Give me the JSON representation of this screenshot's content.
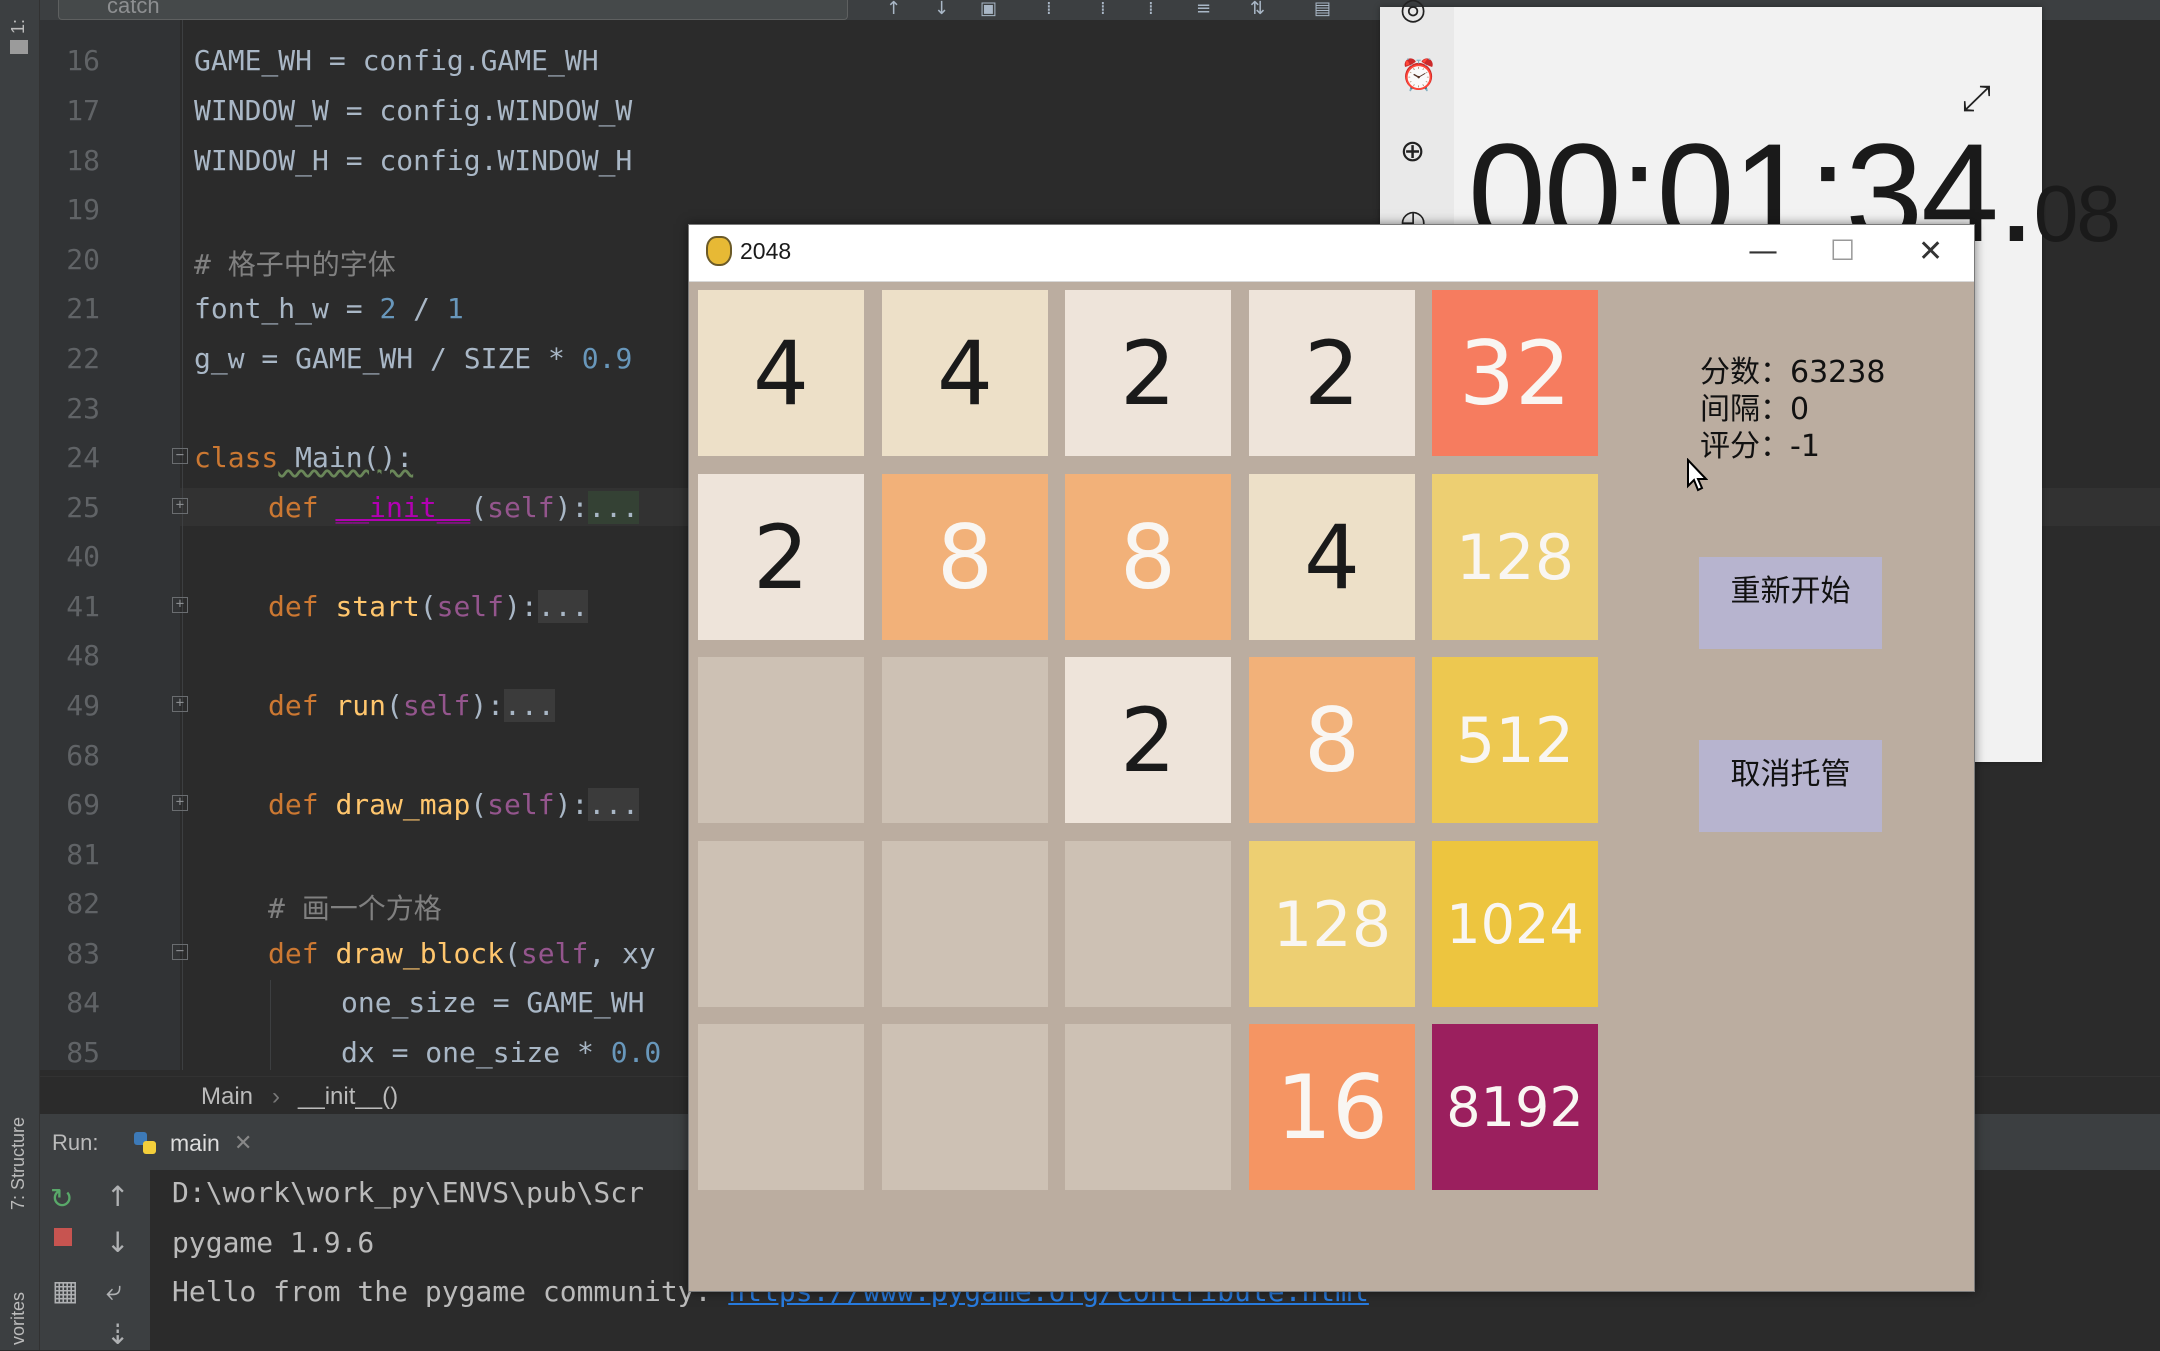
{
  "ide": {
    "search_text": "catch",
    "side_project_label": "1:",
    "side_structure_label": "7: Structure",
    "side_favorites_label": "vorites",
    "line_numbers": [
      "16",
      "17",
      "18",
      "19",
      "20",
      "21",
      "22",
      "23",
      "24",
      "25",
      "40",
      "41",
      "48",
      "49",
      "68",
      "69",
      "81",
      "82",
      "83",
      "84",
      "85"
    ],
    "code": {
      "l16_a": "GAME_WH = config.GAME_WH",
      "l17_a": "WINDOW_W = config.WINDOW_W",
      "l18_a": "WINDOW_H = config.WINDOW_H",
      "l20_comment": "# 格子中的字体",
      "l21_a": "font_h_w = ",
      "l21_n1": "2",
      "l21_b": " / ",
      "l21_n2": "1",
      "l22_a": "g_w = GAME_WH / SIZE * ",
      "l22_n": "0.9",
      "l24_kw": "class",
      "l24_name": " Main():",
      "l25_kw": "def",
      "l25_fn": "__init__",
      "l25_self": "self",
      "dots": "...",
      "l41_fn": "start",
      "l49_fn": "run",
      "l69_fn": "draw_map",
      "l82_comment": "# 画一个方格",
      "l83_fn": "draw_block",
      "l83_rest": ", xy",
      "l84_a": "one_size = GAME_WH",
      "l85_a": "dx = one_size * ",
      "l85_n": "0.0",
      "def": "def",
      "self": "self",
      "paren_open": "(",
      "paren_close": "):"
    },
    "breadcrumb": [
      "Main",
      "›",
      "__init__()"
    ],
    "run_label": "Run:",
    "run_tab": "main",
    "console": {
      "line1": "D:\\work\\work_py\\ENVS\\pub\\Scr",
      "line2": "pygame 1.9.6",
      "line3_text": "Hello from the pygame community. ",
      "line3_link": "https://www.pygame.org/contribute.html"
    }
  },
  "clock": {
    "time_main": "00:01:34.",
    "time_ms": "08"
  },
  "game": {
    "title": "2048",
    "window_controls": {
      "minimize": "—",
      "maximize": "☐",
      "close": "✕"
    },
    "grid": [
      [
        4,
        4,
        2,
        2,
        32
      ],
      [
        2,
        8,
        8,
        4,
        128
      ],
      [
        0,
        0,
        2,
        8,
        512
      ],
      [
        0,
        0,
        0,
        128,
        1024
      ],
      [
        0,
        0,
        0,
        16,
        8192
      ]
    ],
    "tile_colors": {
      "0": "#cdc1b4",
      "2": "#eee4da",
      "4": "#ede0c8",
      "8": "#f2b179",
      "16": "#f59563",
      "32": "#f67c5f",
      "128": "#edcf72",
      "512": "#edc850",
      "1024": "#edc53f",
      "8192": "#9b1f5e"
    },
    "stats": {
      "score": "分数：63238",
      "interval": "间隔：0",
      "rating": "评分：-1"
    },
    "restart_button": "重新开始",
    "cancel_auto_button": "取消托管"
  }
}
